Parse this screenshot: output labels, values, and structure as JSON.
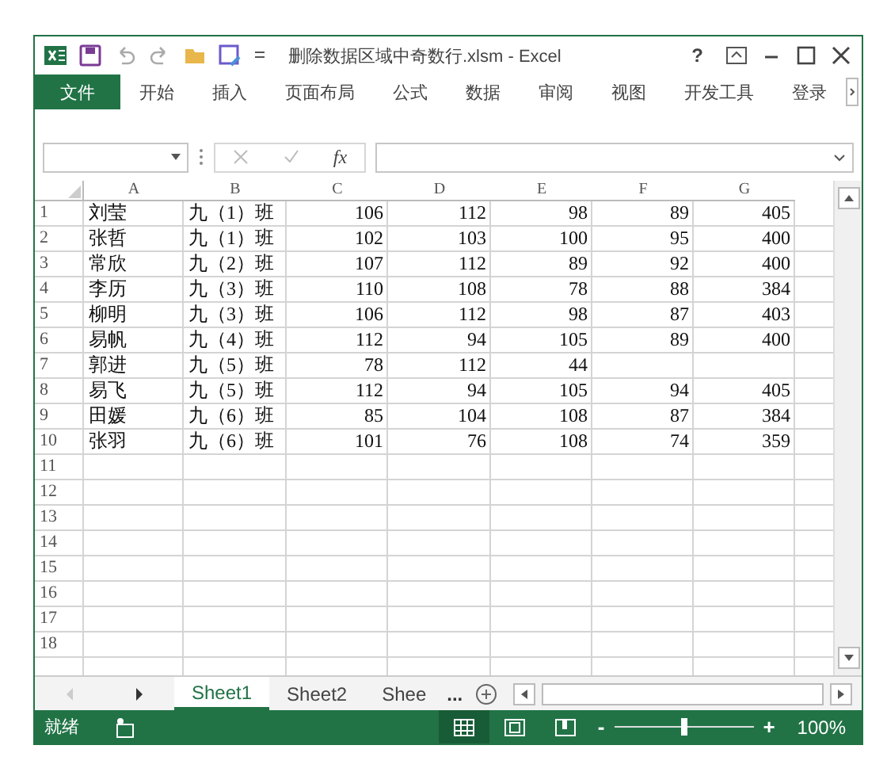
{
  "window": {
    "title": "删除数据区域中奇数行.xlsm - Excel",
    "help": "?"
  },
  "ribbon_tabs": [
    {
      "label": "文件",
      "kind": "file",
      "selected": true
    },
    {
      "label": "开始",
      "kind": "tab",
      "selected": false
    },
    {
      "label": "插入",
      "kind": "tab",
      "selected": false
    },
    {
      "label": "页面布局",
      "kind": "tab",
      "selected": false
    },
    {
      "label": "公式",
      "kind": "tab",
      "selected": false
    },
    {
      "label": "数据",
      "kind": "tab",
      "selected": false
    },
    {
      "label": "审阅",
      "kind": "tab",
      "selected": false
    },
    {
      "label": "视图",
      "kind": "tab",
      "selected": false
    },
    {
      "label": "开发工具",
      "kind": "tab",
      "selected": false
    },
    {
      "label": "登录",
      "kind": "tab",
      "selected": false
    }
  ],
  "formula_bar": {
    "function_label": "fx"
  },
  "sheet": {
    "columns": [
      "A",
      "B",
      "C",
      "D",
      "E",
      "F",
      "G"
    ],
    "rows": [
      {
        "number": "1",
        "cells": [
          "刘莹",
          "九（1）班",
          "106",
          "112",
          "98",
          "89",
          "405"
        ]
      },
      {
        "number": "2",
        "cells": [
          "张哲",
          "九（1）班",
          "102",
          "103",
          "100",
          "95",
          "400"
        ]
      },
      {
        "number": "3",
        "cells": [
          "常欣",
          "九（2）班",
          "107",
          "112",
          "89",
          "92",
          "400"
        ]
      },
      {
        "number": "4",
        "cells": [
          "李历",
          "九（3）班",
          "110",
          "108",
          "78",
          "88",
          "384"
        ]
      },
      {
        "number": "5",
        "cells": [
          "柳明",
          "九（3）班",
          "106",
          "112",
          "98",
          "87",
          "403"
        ]
      },
      {
        "number": "6",
        "cells": [
          "易帆",
          "九（4）班",
          "112",
          "94",
          "105",
          "89",
          "400"
        ]
      },
      {
        "number": "7",
        "cells": [
          "郭进",
          "九（5）班",
          "78",
          "112",
          "44"
        ]
      },
      {
        "number": "8",
        "cells": [
          "易飞",
          "九（5）班",
          "112",
          "94",
          "105",
          "94",
          "405"
        ]
      },
      {
        "number": "9",
        "cells": [
          "田媛",
          "九（6）班",
          "85",
          "104",
          "108",
          "87",
          "384"
        ]
      },
      {
        "number": "10",
        "cells": [
          "张羽",
          "九（6）班",
          "101",
          "76",
          "108",
          "74",
          "359"
        ]
      },
      {
        "number": "11",
        "cells": []
      },
      {
        "number": "12",
        "cells": []
      },
      {
        "number": "13",
        "cells": []
      },
      {
        "number": "14",
        "cells": []
      },
      {
        "number": "15",
        "cells": []
      },
      {
        "number": "16",
        "cells": []
      },
      {
        "number": "17",
        "cells": []
      },
      {
        "number": "18",
        "cells": []
      }
    ]
  },
  "sheet_tabs": [
    {
      "label": "Sheet1",
      "selected": true
    },
    {
      "label": "Sheet2",
      "selected": false
    },
    {
      "label": "Shee",
      "selected": false
    }
  ],
  "more_sheets": "...",
  "status_bar": {
    "status": "就绪",
    "views": [
      {
        "kind": "normal",
        "selected": true
      },
      {
        "kind": "layout",
        "selected": false
      },
      {
        "kind": "break",
        "selected": false
      }
    ],
    "zoom_slider": {
      "level": 0.5
    },
    "zoom": "100%",
    "minus": "-",
    "plus": "+"
  }
}
